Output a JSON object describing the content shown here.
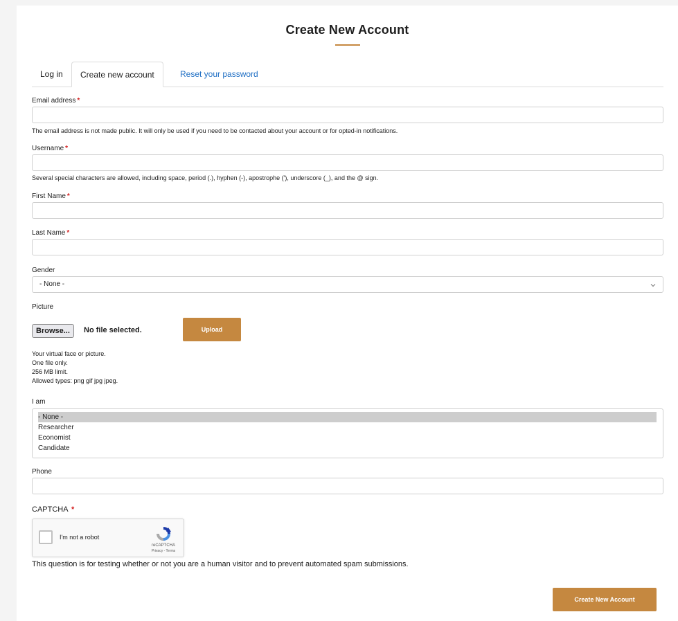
{
  "page": {
    "title": "Create New Account"
  },
  "tabs": [
    {
      "label": "Log in"
    },
    {
      "label": "Create new account"
    },
    {
      "label": "Reset your password"
    }
  ],
  "form": {
    "required_mark": "*",
    "email": {
      "label": "Email address",
      "value": "",
      "help": "The email address is not made public. It will only be used if you need to be contacted about your account or for opted-in notifications."
    },
    "username": {
      "label": "Username",
      "value": "",
      "help": "Several special characters are allowed, including space, period (.), hyphen (-), apostrophe ('), underscore (_), and the @ sign."
    },
    "first_name": {
      "label": "First Name",
      "value": ""
    },
    "last_name": {
      "label": "Last Name",
      "value": ""
    },
    "gender": {
      "label": "Gender",
      "selected": "- None -"
    },
    "picture": {
      "label": "Picture",
      "browse_label": "Browse...",
      "file_status": "No file selected.",
      "upload_label": "Upload",
      "help": [
        "Your virtual face or picture.",
        "One file only.",
        "256 MB limit.",
        "Allowed types: png gif jpg jpeg."
      ]
    },
    "i_am": {
      "label": "I am",
      "options": [
        "- None -",
        "Researcher",
        "Economist",
        "Candidate"
      ],
      "selected_index": 0
    },
    "phone": {
      "label": "Phone",
      "value": ""
    },
    "captcha": {
      "label": "CAPTCHA",
      "checkbox_label": "I'm not a robot",
      "brand": "reCAPTCHA",
      "terms": "Privacy - Terms",
      "help": "This question is for testing whether or not you are a human visitor and to prevent automated spam submissions."
    },
    "submit_label": "Create New Account"
  },
  "colors": {
    "accent": "#c58840",
    "link": "#1f6fc4",
    "required": "#d42020"
  }
}
